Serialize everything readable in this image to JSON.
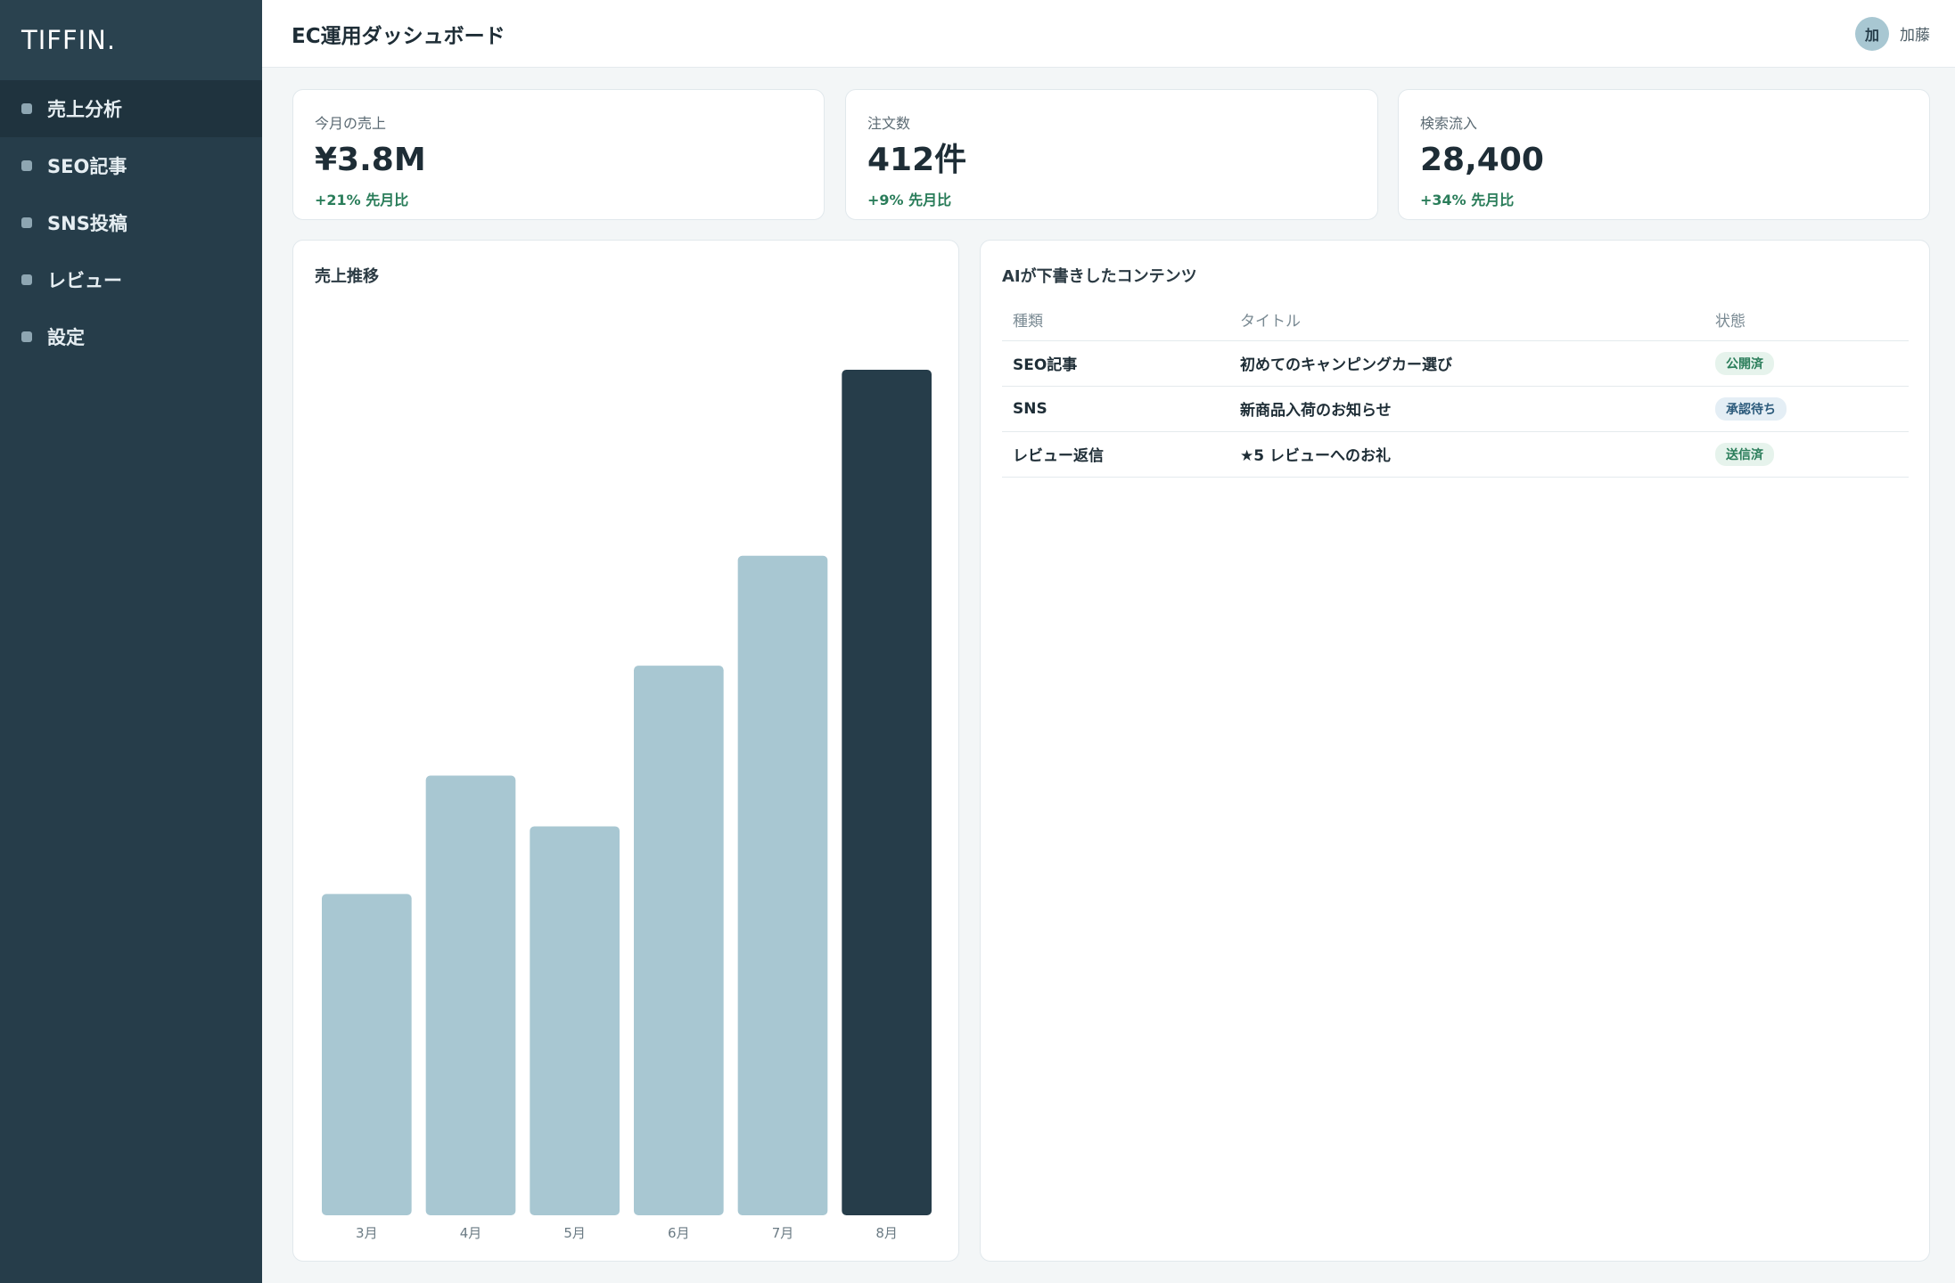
{
  "sidebar": {
    "logo": "TIFFIN.",
    "items": [
      {
        "label": "売上分析",
        "active": true
      },
      {
        "label": "SEO記事",
        "active": false
      },
      {
        "label": "SNS投稿",
        "active": false
      },
      {
        "label": "レビュー",
        "active": false
      },
      {
        "label": "設定",
        "active": false
      }
    ]
  },
  "header": {
    "title": "EC運用ダッシュボード",
    "user": {
      "avatar_initial": "加",
      "name": "加藤"
    }
  },
  "kpis": [
    {
      "label": "今月の売上",
      "value": "¥3.8M",
      "change": "+21% 先月比"
    },
    {
      "label": "注文数",
      "value": "412件",
      "change": "+9% 先月比"
    },
    {
      "label": "検索流入",
      "value": "28,400",
      "change": "+34% 先月比"
    }
  ],
  "sales_panel": {
    "title": "売上推移"
  },
  "chart_data": {
    "type": "bar",
    "categories": [
      "3月",
      "4月",
      "5月",
      "6月",
      "7月",
      "8月"
    ],
    "values": [
      38,
      52,
      46,
      65,
      78,
      100
    ],
    "highlight_index": 5,
    "colors": {
      "default": "#a8c7d2",
      "highlight": "#263d4a"
    },
    "title": "売上推移",
    "xlabel": "",
    "ylabel": "",
    "ylim": [
      0,
      100
    ],
    "grid": false
  },
  "content_panel": {
    "title": "AIが下書きしたコンテンツ",
    "columns": [
      "種類",
      "タイトル",
      "状態"
    ],
    "rows": [
      {
        "type": "SEO記事",
        "title": "初めてのキャンピングカー選び",
        "status": "公開済",
        "status_color": "green"
      },
      {
        "type": "SNS",
        "title": "新商品入荷のお知らせ",
        "status": "承認待ち",
        "status_color": "blue"
      },
      {
        "type": "レビュー返信",
        "title": "★5 レビューへのお礼",
        "status": "送信済",
        "status_color": "green"
      }
    ]
  },
  "colors": {
    "sidebar": "#263d4a",
    "accent_light": "#a8c7d2",
    "positive": "#2a7d5a"
  }
}
